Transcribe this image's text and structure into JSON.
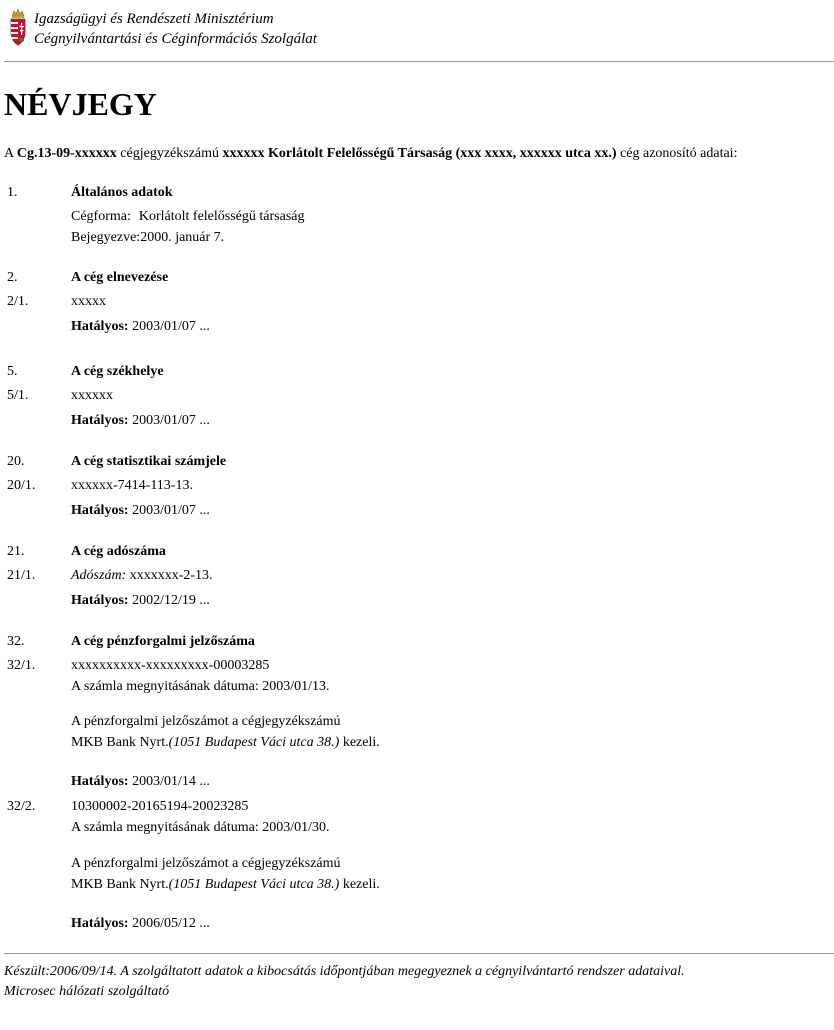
{
  "header": {
    "line1": "Igazságügyi és Rendészeti Minisztérium",
    "line2": "Cégnyilvántartási és Céginformációs Szolgálat"
  },
  "title": "NÉVJEGY",
  "intro": {
    "prefix": "A ",
    "reg_number": "Cg.13-09-xxxxxx",
    "middle": " cégjegyzékszámú ",
    "company": "xxxxxx Korlátolt Felelősségű Társaság (xxx xxxx, xxxxxx utca xx.)",
    "suffix": " cég azonosító adatai:"
  },
  "general": {
    "num": "1.",
    "title": "Általános adatok",
    "form_label": "Cégforma:",
    "form_value": "Korlátolt felelősségű társaság",
    "reg_label": "Bejegyezve:",
    "reg_value": "2000. január 7."
  },
  "effective_label": "Hatályos:",
  "sec2": {
    "num": "2.",
    "title": "A cég elnevezése",
    "sub_num": "2/1.",
    "value": "xxxxx",
    "effective": " 2003/01/07 ..."
  },
  "sec5": {
    "num": "5.",
    "title": "A cég székhelye",
    "sub_num": "5/1.",
    "value": "xxxxxx",
    "effective": " 2003/01/07 ..."
  },
  "sec20": {
    "num": "20.",
    "title": "A cég statisztikai számjele",
    "sub_num": "20/1.",
    "value": "xxxxxx-7414-113-13.",
    "effective": " 2003/01/07 ..."
  },
  "sec21": {
    "num": "21.",
    "title": "A cég adószáma",
    "sub_num": "21/1.",
    "label": "Adószám:",
    "value": " xxxxxxx-2-13.",
    "effective": " 2002/12/19 ..."
  },
  "sec32": {
    "num": "32.",
    "title": "A cég pénzforgalmi jelzőszáma",
    "accounts": [
      {
        "sub_num": "32/1.",
        "account": "xxxxxxxxxx-xxxxxxxxx-00003285",
        "opened": "A számla megnyitásának dátuma: 2003/01/13.",
        "managed_line1": "A pénzforgalmi jelzőszámot a cégjegyzékszámú",
        "bank": "MKB Bank Nyrt.",
        "bank_address": "(1051 Budapest Váci utca 38.)",
        "managed_suffix": " kezeli.",
        "effective": " 2003/01/14 ..."
      },
      {
        "sub_num": "32/2.",
        "account": "10300002-20165194-20023285",
        "opened": "A számla megnyitásának dátuma: 2003/01/30.",
        "managed_line1": "A pénzforgalmi jelzőszámot a cégjegyzékszámú",
        "bank": "MKB Bank Nyrt.",
        "bank_address": "(1051 Budapest Váci utca 38.)",
        "managed_suffix": " kezeli.",
        "effective": " 2006/05/12 ..."
      }
    ]
  },
  "footer": {
    "line1": "Készült:2006/09/14. A szolgáltatott adatok a kibocsátás időpontjában megegyeznek a cégnyilvántartó rendszer adataival.",
    "line2": "Microsec hálózati szolgáltató"
  }
}
